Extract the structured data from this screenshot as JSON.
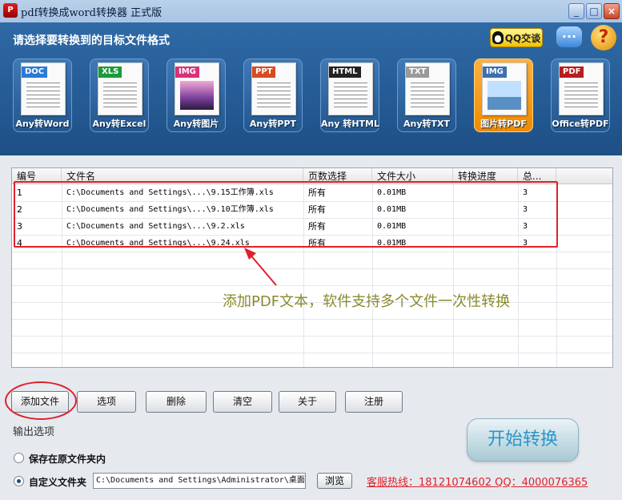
{
  "window": {
    "icon_text": "P",
    "title": "pdf转换成word转换器 正式版",
    "minimize_icon": "_",
    "maximize_icon": "□",
    "close_icon": "×"
  },
  "header": {
    "instruction": "请选择要转换到的目标文件格式",
    "qq_label": "QQ交谈",
    "chat_glyph": "...",
    "help_glyph": "?"
  },
  "formats": [
    {
      "tag": "DOC",
      "label": "Any转Word",
      "tag_color": "#2c7ad6",
      "active": false
    },
    {
      "tag": "XLS",
      "label": "Any转Excel",
      "tag_color": "#1d9a3a",
      "active": false
    },
    {
      "tag": "IMG",
      "label": "Any转图片",
      "tag_color": "#d8327a",
      "active": false
    },
    {
      "tag": "PPT",
      "label": "Any转PPT",
      "tag_color": "#d94a1e",
      "active": false
    },
    {
      "tag": "HTML",
      "label": "Any 转HTML",
      "tag_color": "#222222",
      "active": false
    },
    {
      "tag": "TXT",
      "label": "Any转TXT",
      "tag_color": "#9a9a9a",
      "active": false
    },
    {
      "tag": "IMG",
      "label": "图片转PDF",
      "tag_color": "#3d6fb0",
      "active": true
    },
    {
      "tag": "PDF",
      "label": "Office转PDF",
      "tag_color": "#b81d1d",
      "active": false
    }
  ],
  "table": {
    "columns": [
      "编号",
      "文件名",
      "页数选择",
      "文件大小",
      "转换进度",
      "总..."
    ],
    "rows": [
      {
        "no": "1",
        "file": "C:\\Documents and Settings\\...\\9.15工作簿.xls",
        "pages": "所有",
        "size": "0.01MB",
        "progress": "",
        "total": "3"
      },
      {
        "no": "2",
        "file": "C:\\Documents and Settings\\...\\9.10工作簿.xls",
        "pages": "所有",
        "size": "0.01MB",
        "progress": "",
        "total": "3"
      },
      {
        "no": "3",
        "file": "C:\\Documents and Settings\\...\\9.2.xls",
        "pages": "所有",
        "size": "0.01MB",
        "progress": "",
        "total": "3"
      },
      {
        "no": "4",
        "file": "C:\\Documents and Settings\\...\\9.24.xls",
        "pages": "所有",
        "size": "0.01MB",
        "progress": "",
        "total": "3"
      }
    ],
    "annotation": "添加PDF文本，软件支持多个文件一次性转换"
  },
  "toolbar": {
    "add_file": "添加文件",
    "options": "选项",
    "delete": "删除",
    "clear": "清空",
    "about": "关于",
    "register": "注册"
  },
  "output": {
    "section_label": "输出选项",
    "opt_same_folder": "保存在原文件夹内",
    "opt_custom_folder": "自定义文件夹",
    "selected": "custom",
    "custom_path": "C:\\Documents and Settings\\Administrator\\桌面",
    "browse": "浏览",
    "hotline": "客服热线：18121074602 QQ：4000076365",
    "start": "开始转换"
  }
}
